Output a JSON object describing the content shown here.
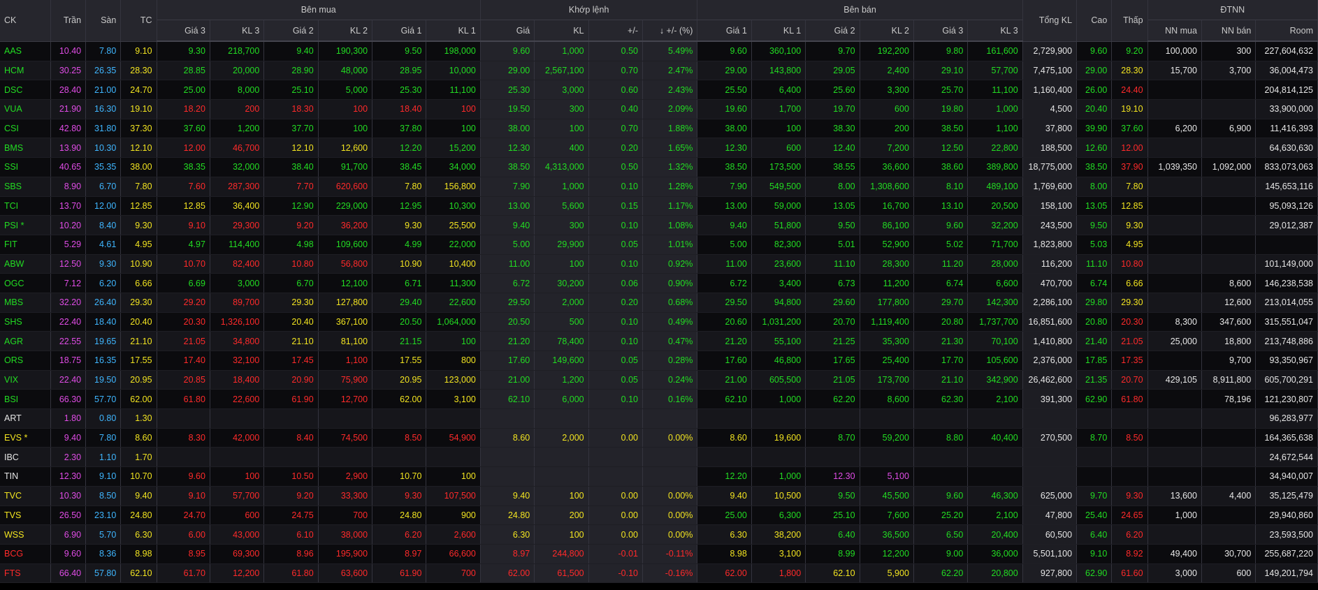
{
  "header": {
    "ck": "CK",
    "tran": "Trần",
    "san": "Sàn",
    "tc": "TC",
    "ben_mua": "Bên mua",
    "khop_lenh": "Khớp lệnh",
    "ben_ban": "Bên bán",
    "tong_kl": "Tổng KL",
    "cao": "Cao",
    "thap": "Thấp",
    "dtnn": "ĐTNN",
    "gia3": "Giá 3",
    "kl3": "KL 3",
    "gia2": "Giá 2",
    "kl2": "KL 2",
    "gia1": "Giá 1",
    "kl1": "KL 1",
    "gia": "Giá",
    "kl": "KL",
    "change": "+/-",
    "sort_arrow": "↓",
    "change_pct": "+/- (%)",
    "nn_mua": "NN mua",
    "nn_ban": "NN bán",
    "room": "Room"
  },
  "colors": {
    "up": "#22dc22",
    "down": "#ff2a2a",
    "ref": "#f2e420",
    "ceiling": "#e04ce6",
    "floor": "#3fb6ff",
    "neutral": "#e6e6e6"
  },
  "rows": [
    [
      "AAS",
      "10.40",
      "7.80",
      "9.10",
      "9.30",
      "218,700",
      "9.40",
      "190,300",
      "9.50",
      "198,000",
      "9.60",
      "1,000",
      "0.50",
      "5.49%",
      "9.60",
      "360,100",
      "9.70",
      "192,200",
      "9.80",
      "161,600",
      "2,729,900",
      "9.60",
      "9.20",
      "100,000",
      "300",
      "227,604,632"
    ],
    [
      "HCM",
      "30.25",
      "26.35",
      "28.30",
      "28.85",
      "20,000",
      "28.90",
      "48,000",
      "28.95",
      "10,000",
      "29.00",
      "2,567,100",
      "0.70",
      "2.47%",
      "29.00",
      "143,800",
      "29.05",
      "2,400",
      "29.10",
      "57,700",
      "7,475,100",
      "29.00",
      "28.30",
      "15,700",
      "3,700",
      "36,004,473"
    ],
    [
      "DSC",
      "28.40",
      "21.00",
      "24.70",
      "25.00",
      "8,000",
      "25.10",
      "5,000",
      "25.30",
      "11,100",
      "25.30",
      "3,000",
      "0.60",
      "2.43%",
      "25.50",
      "6,400",
      "25.60",
      "3,300",
      "25.70",
      "11,100",
      "1,160,400",
      "26.00",
      "24.40",
      "",
      "",
      "204,814,125"
    ],
    [
      "VUA",
      "21.90",
      "16.30",
      "19.10",
      "18.20",
      "200",
      "18.30",
      "100",
      "18.40",
      "100",
      "19.50",
      "300",
      "0.40",
      "2.09%",
      "19.60",
      "1,700",
      "19.70",
      "600",
      "19.80",
      "1,000",
      "4,500",
      "20.40",
      "19.10",
      "",
      "",
      "33,900,000"
    ],
    [
      "CSI",
      "42.80",
      "31.80",
      "37.30",
      "37.60",
      "1,200",
      "37.70",
      "100",
      "37.80",
      "100",
      "38.00",
      "100",
      "0.70",
      "1.88%",
      "38.00",
      "100",
      "38.30",
      "200",
      "38.50",
      "1,100",
      "37,800",
      "39.90",
      "37.60",
      "6,200",
      "6,900",
      "11,416,393"
    ],
    [
      "BMS",
      "13.90",
      "10.30",
      "12.10",
      "12.00",
      "46,700",
      "12.10",
      "12,600",
      "12.20",
      "15,200",
      "12.30",
      "400",
      "0.20",
      "1.65%",
      "12.30",
      "600",
      "12.40",
      "7,200",
      "12.50",
      "22,800",
      "188,500",
      "12.60",
      "12.00",
      "",
      "",
      "64,630,630"
    ],
    [
      "SSI",
      "40.65",
      "35.35",
      "38.00",
      "38.35",
      "32,000",
      "38.40",
      "91,700",
      "38.45",
      "34,000",
      "38.50",
      "4,313,000",
      "0.50",
      "1.32%",
      "38.50",
      "173,500",
      "38.55",
      "36,600",
      "38.60",
      "389,800",
      "18,775,000",
      "38.50",
      "37.90",
      "1,039,350",
      "1,092,000",
      "833,073,063"
    ],
    [
      "SBS",
      "8.90",
      "6.70",
      "7.80",
      "7.60",
      "287,300",
      "7.70",
      "620,600",
      "7.80",
      "156,800",
      "7.90",
      "1,000",
      "0.10",
      "1.28%",
      "7.90",
      "549,500",
      "8.00",
      "1,308,600",
      "8.10",
      "489,100",
      "1,769,600",
      "8.00",
      "7.80",
      "",
      "",
      "145,653,116"
    ],
    [
      "TCI",
      "13.70",
      "12.00",
      "12.85",
      "12.85",
      "36,400",
      "12.90",
      "229,000",
      "12.95",
      "10,300",
      "13.00",
      "5,600",
      "0.15",
      "1.17%",
      "13.00",
      "59,000",
      "13.05",
      "16,700",
      "13.10",
      "20,500",
      "158,100",
      "13.05",
      "12.85",
      "",
      "",
      "95,093,126"
    ],
    [
      "PSI *",
      "10.20",
      "8.40",
      "9.30",
      "9.10",
      "29,300",
      "9.20",
      "36,200",
      "9.30",
      "25,500",
      "9.40",
      "300",
      "0.10",
      "1.08%",
      "9.40",
      "51,800",
      "9.50",
      "86,100",
      "9.60",
      "32,200",
      "243,500",
      "9.50",
      "9.30",
      "",
      "",
      "29,012,387"
    ],
    [
      "FIT",
      "5.29",
      "4.61",
      "4.95",
      "4.97",
      "114,400",
      "4.98",
      "109,600",
      "4.99",
      "22,000",
      "5.00",
      "29,900",
      "0.05",
      "1.01%",
      "5.00",
      "82,300",
      "5.01",
      "52,900",
      "5.02",
      "71,700",
      "1,823,800",
      "5.03",
      "4.95",
      "",
      "",
      ""
    ],
    [
      "ABW",
      "12.50",
      "9.30",
      "10.90",
      "10.70",
      "82,400",
      "10.80",
      "56,800",
      "10.90",
      "10,400",
      "11.00",
      "100",
      "0.10",
      "0.92%",
      "11.00",
      "23,600",
      "11.10",
      "28,300",
      "11.20",
      "28,000",
      "116,200",
      "11.10",
      "10.80",
      "",
      "",
      "101,149,000"
    ],
    [
      "OGC",
      "7.12",
      "6.20",
      "6.66",
      "6.69",
      "3,000",
      "6.70",
      "12,100",
      "6.71",
      "11,300",
      "6.72",
      "30,200",
      "0.06",
      "0.90%",
      "6.72",
      "3,400",
      "6.73",
      "11,200",
      "6.74",
      "6,600",
      "470,700",
      "6.74",
      "6.66",
      "",
      "8,600",
      "146,238,538"
    ],
    [
      "MBS",
      "32.20",
      "26.40",
      "29.30",
      "29.20",
      "89,700",
      "29.30",
      "127,800",
      "29.40",
      "22,600",
      "29.50",
      "2,000",
      "0.20",
      "0.68%",
      "29.50",
      "94,800",
      "29.60",
      "177,800",
      "29.70",
      "142,300",
      "2,286,100",
      "29.80",
      "29.30",
      "",
      "12,600",
      "213,014,055"
    ],
    [
      "SHS",
      "22.40",
      "18.40",
      "20.40",
      "20.30",
      "1,326,100",
      "20.40",
      "367,100",
      "20.50",
      "1,064,000",
      "20.50",
      "500",
      "0.10",
      "0.49%",
      "20.60",
      "1,031,200",
      "20.70",
      "1,119,400",
      "20.80",
      "1,737,700",
      "16,851,600",
      "20.80",
      "20.30",
      "8,300",
      "347,600",
      "315,551,047"
    ],
    [
      "AGR",
      "22.55",
      "19.65",
      "21.10",
      "21.05",
      "34,800",
      "21.10",
      "81,100",
      "21.15",
      "100",
      "21.20",
      "78,400",
      "0.10",
      "0.47%",
      "21.20",
      "55,100",
      "21.25",
      "35,300",
      "21.30",
      "70,100",
      "1,410,800",
      "21.40",
      "21.05",
      "25,000",
      "18,800",
      "213,748,886"
    ],
    [
      "ORS",
      "18.75",
      "16.35",
      "17.55",
      "17.40",
      "32,100",
      "17.45",
      "1,100",
      "17.55",
      "800",
      "17.60",
      "149,600",
      "0.05",
      "0.28%",
      "17.60",
      "46,800",
      "17.65",
      "25,400",
      "17.70",
      "105,600",
      "2,376,000",
      "17.85",
      "17.35",
      "",
      "9,700",
      "93,350,967"
    ],
    [
      "VIX",
      "22.40",
      "19.50",
      "20.95",
      "20.85",
      "18,400",
      "20.90",
      "75,900",
      "20.95",
      "123,000",
      "21.00",
      "1,200",
      "0.05",
      "0.24%",
      "21.00",
      "605,500",
      "21.05",
      "173,700",
      "21.10",
      "342,900",
      "26,462,600",
      "21.35",
      "20.70",
      "429,105",
      "8,911,800",
      "605,700,291"
    ],
    [
      "BSI",
      "66.30",
      "57.70",
      "62.00",
      "61.80",
      "22,600",
      "61.90",
      "12,700",
      "62.00",
      "3,100",
      "62.10",
      "6,000",
      "0.10",
      "0.16%",
      "62.10",
      "1,000",
      "62.20",
      "8,600",
      "62.30",
      "2,100",
      "391,300",
      "62.90",
      "61.80",
      "",
      "78,196",
      "121,230,807"
    ],
    [
      "ART",
      "1.80",
      "0.80",
      "1.30",
      "",
      "",
      "",
      "",
      "",
      "",
      "",
      "",
      "",
      "",
      "",
      "",
      "",
      "",
      "",
      "",
      "",
      "",
      "",
      "",
      "",
      "96,283,977"
    ],
    [
      "EVS *",
      "9.40",
      "7.80",
      "8.60",
      "8.30",
      "42,000",
      "8.40",
      "74,500",
      "8.50",
      "54,900",
      "8.60",
      "2,000",
      "0.00",
      "0.00%",
      "8.60",
      "19,600",
      "8.70",
      "59,200",
      "8.80",
      "40,400",
      "270,500",
      "8.70",
      "8.50",
      "",
      "",
      "164,365,638"
    ],
    [
      "IBC",
      "2.30",
      "1.10",
      "1.70",
      "",
      "",
      "",
      "",
      "",
      "",
      "",
      "",
      "",
      "",
      "",
      "",
      "",
      "",
      "",
      "",
      "",
      "",
      "",
      "",
      "",
      "24,672,544"
    ],
    [
      "TIN",
      "12.30",
      "9.10",
      "10.70",
      "9.60",
      "100",
      "10.50",
      "2,900",
      "10.70",
      "100",
      "",
      "",
      "",
      "",
      "12.20",
      "1,000",
      "12.30",
      "5,100",
      "",
      "",
      "",
      "",
      "",
      "",
      "",
      "34,940,007"
    ],
    [
      "TVC",
      "10.30",
      "8.50",
      "9.40",
      "9.10",
      "57,700",
      "9.20",
      "33,300",
      "9.30",
      "107,500",
      "9.40",
      "100",
      "0.00",
      "0.00%",
      "9.40",
      "10,500",
      "9.50",
      "45,500",
      "9.60",
      "46,300",
      "625,000",
      "9.70",
      "9.30",
      "13,600",
      "4,400",
      "35,125,479"
    ],
    [
      "TVS",
      "26.50",
      "23.10",
      "24.80",
      "24.70",
      "600",
      "24.75",
      "700",
      "24.80",
      "900",
      "24.80",
      "200",
      "0.00",
      "0.00%",
      "25.00",
      "6,300",
      "25.10",
      "7,600",
      "25.20",
      "2,100",
      "47,800",
      "25.40",
      "24.65",
      "1,000",
      "",
      "29,940,860"
    ],
    [
      "WSS",
      "6.90",
      "5.70",
      "6.30",
      "6.00",
      "43,000",
      "6.10",
      "38,000",
      "6.20",
      "2,600",
      "6.30",
      "100",
      "0.00",
      "0.00%",
      "6.30",
      "38,200",
      "6.40",
      "36,500",
      "6.50",
      "20,400",
      "60,500",
      "6.40",
      "6.20",
      "",
      "",
      "23,593,500"
    ],
    [
      "BCG",
      "9.60",
      "8.36",
      "8.98",
      "8.95",
      "69,300",
      "8.96",
      "195,900",
      "8.97",
      "66,600",
      "8.97",
      "244,800",
      "-0.01",
      "-0.11%",
      "8.98",
      "3,100",
      "8.99",
      "12,200",
      "9.00",
      "36,000",
      "5,501,100",
      "9.10",
      "8.92",
      "49,400",
      "30,700",
      "255,687,220"
    ],
    [
      "FTS",
      "66.40",
      "57.80",
      "62.10",
      "61.70",
      "12,200",
      "61.80",
      "63,600",
      "61.90",
      "700",
      "62.00",
      "61,500",
      "-0.10",
      "-0.16%",
      "62.00",
      "1,800",
      "62.10",
      "5,900",
      "62.20",
      "20,800",
      "927,800",
      "62.90",
      "61.60",
      "3,000",
      "600",
      "149,201,794"
    ]
  ]
}
